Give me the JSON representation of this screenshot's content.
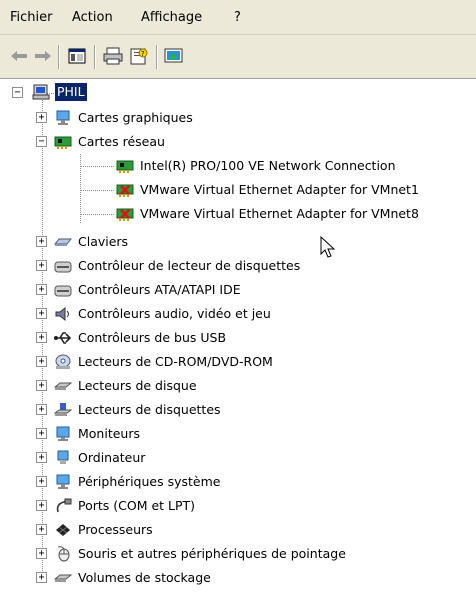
{
  "menu": [
    "Fichier",
    "Action",
    "Affichage",
    "?"
  ],
  "toolbar": {
    "buttons": [
      "back-arrow-icon",
      "forward-arrow-icon",
      "show-hide-console-tree-icon",
      "print-icon",
      "properties-icon",
      "help-icon"
    ]
  },
  "tree": {
    "root": "PHIL",
    "network_label": "Cartes réseau",
    "network_children": [
      "Intel(R) PRO/100 VE Network Connection",
      "VMware Virtual Ethernet Adapter for VMnet1",
      "VMware Virtual Ethernet Adapter for VMnet8"
    ],
    "categories": [
      "Cartes graphiques",
      "Claviers",
      "Contrôleur de lecteur de disquettes",
      "Contrôleurs ATA/ATAPI IDE",
      "Contrôleurs audio, vidéo et jeu",
      "Contrôleurs de bus USB",
      "Lecteurs de CD-ROM/DVD-ROM",
      "Lecteurs de disque",
      "Lecteurs de disquettes",
      "Moniteurs",
      "Ordinateur",
      "Périphériques système",
      "Ports (COM et LPT)",
      "Processeurs",
      "Souris et autres périphériques de pointage",
      "Volumes de stockage"
    ]
  },
  "colors": {
    "selection": "#0a246a",
    "menubar": "#ece9d8"
  }
}
